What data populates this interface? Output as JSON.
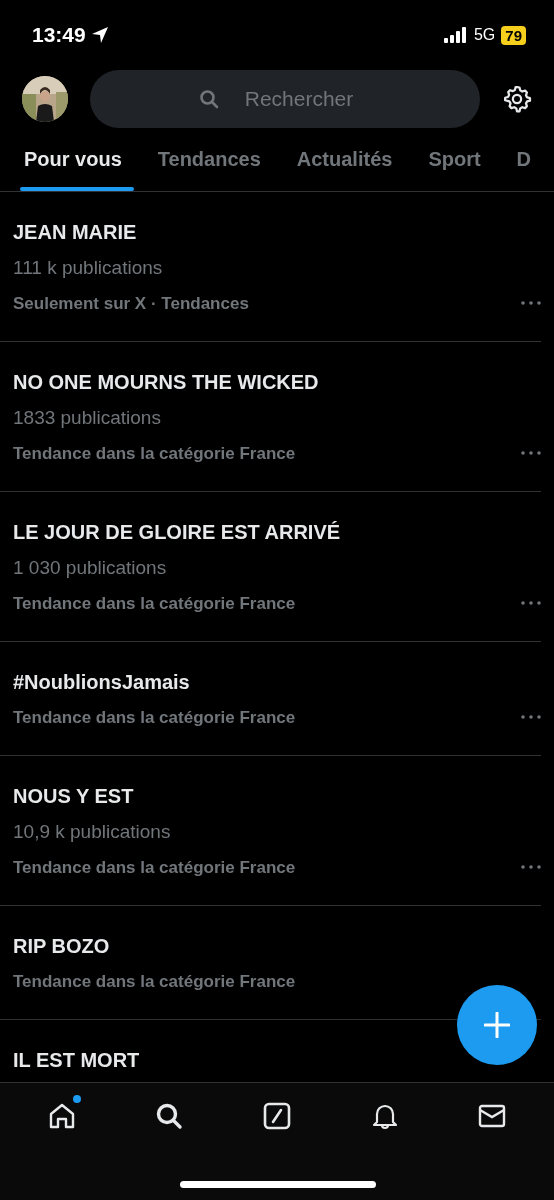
{
  "status_bar": {
    "time": "13:49",
    "network": "5G",
    "battery": "79"
  },
  "header": {
    "search": {
      "placeholder": "Rechercher"
    }
  },
  "tabs": [
    {
      "label": "Pour vous",
      "selected": true
    },
    {
      "label": "Tendances",
      "selected": false
    },
    {
      "label": "Actualités",
      "selected": false
    },
    {
      "label": "Sport",
      "selected": false
    },
    {
      "label": "D",
      "selected": false
    }
  ],
  "trends": [
    {
      "title": "JEAN MARIE",
      "count": "111 k publications",
      "context": "Seulement sur X · Tendances",
      "menu": true
    },
    {
      "title": "NO ONE MOURNS THE WICKED",
      "count": "1833 publications",
      "context": "Tendance dans la catégorie France",
      "menu": true
    },
    {
      "title": "LE JOUR DE GLOIRE EST ARRIVÉ",
      "count": "1 030 publications",
      "context": "Tendance dans la catégorie France",
      "menu": true
    },
    {
      "title": "#NoublionsJamais",
      "context": "Tendance dans la catégorie France",
      "menu": true
    },
    {
      "title": "NOUS Y EST",
      "count": "10,9 k publications",
      "context": "Tendance dans la catégorie France",
      "menu": true
    },
    {
      "title": "RIP BOZO",
      "context": "Tendance dans la catégorie France"
    },
    {
      "title": "IL EST MORT"
    }
  ],
  "nav": [
    {
      "kind": "home",
      "dot": true
    },
    {
      "kind": "search",
      "dot": false
    },
    {
      "kind": "compose",
      "dot": false
    },
    {
      "kind": "bell",
      "dot": false
    },
    {
      "kind": "mail",
      "dot": false
    }
  ]
}
